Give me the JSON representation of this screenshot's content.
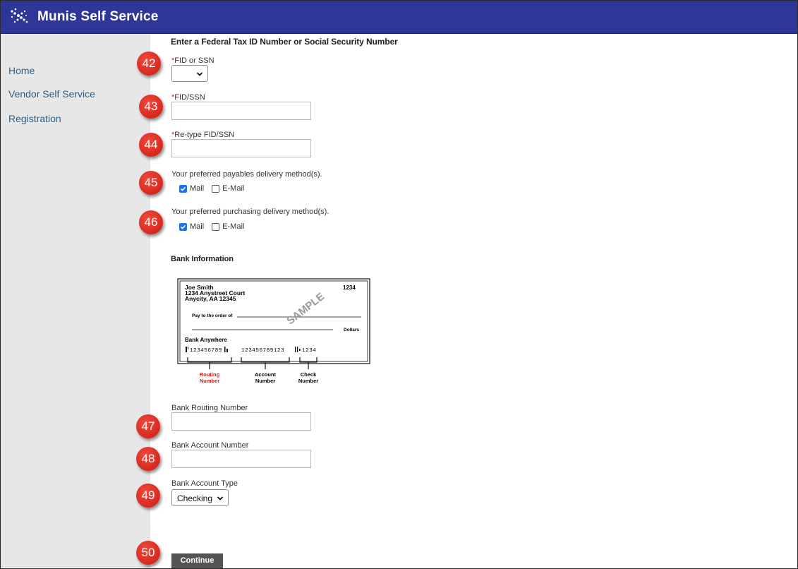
{
  "header": {
    "title": "Munis Self Service",
    "logo_icon": "munis-dots-logo-icon"
  },
  "sidebar": {
    "items": [
      {
        "label": "Home"
      },
      {
        "label": "Vendor Self Service"
      },
      {
        "label": "Registration"
      }
    ]
  },
  "form": {
    "heading": "Enter a Federal Tax ID Number or Social Security Number",
    "required_mark": "*",
    "fid_or_ssn": {
      "label": "FID or SSN",
      "selected": ""
    },
    "fid_ssn": {
      "label": "FID/SSN",
      "value": ""
    },
    "retype_fid_ssn": {
      "label": "Re-type FID/SSN",
      "value": ""
    },
    "payables": {
      "label": "Your preferred payables delivery method(s).",
      "mail": "Mail",
      "email": "E-Mail",
      "mail_checked": true,
      "email_checked": false
    },
    "purchasing": {
      "label": "Your preferred purchasing delivery method(s).",
      "mail": "Mail",
      "email": "E-Mail",
      "mail_checked": true,
      "email_checked": false
    },
    "bank_heading": "Bank Information",
    "routing": {
      "label": "Bank Routing Number",
      "value": ""
    },
    "account": {
      "label": "Bank Account Number",
      "value": ""
    },
    "account_type": {
      "label": "Bank Account Type",
      "selected": "Checking"
    },
    "continue_label": "Continue"
  },
  "sample_check": {
    "name": "Joe Smith",
    "address1": "1234 Anystreet Court",
    "address2": "Anycity, AA 12345",
    "check_no": "1234",
    "pay_to": "Pay to the order of",
    "dollars": "Dollars",
    "bank": "Bank Anywhere",
    "routing_digits": "123456789",
    "account_digits": "123456789123",
    "check_digits": "1234",
    "watermark": "SAMPLE",
    "routing_label_1": "Routing",
    "routing_label_2": "Number",
    "account_label_1": "Account",
    "account_label_2": "Number",
    "check_label_1": "Check",
    "check_label_2": "Number"
  },
  "badges": [
    "42",
    "43",
    "44",
    "45",
    "46",
    "47",
    "48",
    "49",
    "50"
  ],
  "colors": {
    "header_bg": "#2e3798",
    "sidebar_bg": "#e7e7e7",
    "nav_link": "#2e5f84",
    "badge": "#d8281d",
    "required": "#d21c1c",
    "checkbox": "#1a73e8",
    "button": "#545454",
    "routing_label": "#d21c1c"
  }
}
